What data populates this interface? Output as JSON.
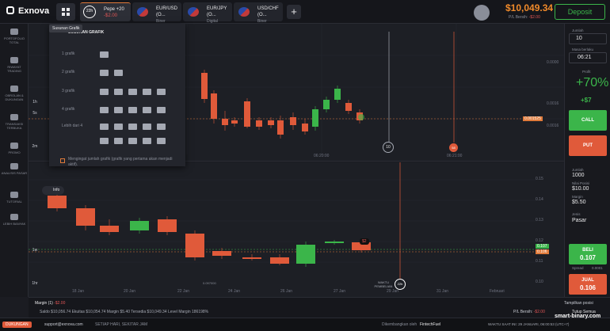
{
  "app": {
    "name": "Exnova"
  },
  "tooltip": "Susunan Grafik",
  "tabs": [
    {
      "timer": "22h",
      "title": "Pepe +20",
      "sub": "-$2.00",
      "active": true
    },
    {
      "title": "EUR/USD (O...",
      "sub": "Biner"
    },
    {
      "title": "EUR/JPY (O...",
      "sub": "Digital"
    },
    {
      "title": "USD/CHF (O...",
      "sub": "Biner"
    }
  ],
  "account": {
    "balance": "$10,049.34",
    "pl_label": "P/L Bersih:",
    "pl_value": "-$2.00",
    "deposit": "Deposit"
  },
  "sidebar": [
    {
      "label": "PORTOFOLIO TOTAL",
      "badge": "2"
    },
    {
      "label": "RIWAYAT TRADING"
    },
    {
      "label": "OBROLAN & DUKUNGAN"
    },
    {
      "label": "TRANSAKSI TERBUKA"
    },
    {
      "label": "PROMO"
    },
    {
      "label": "ANALISIS PASAR"
    },
    {
      "label": "TUTORIAL"
    },
    {
      "label": "LEBIH BANYAK"
    }
  ],
  "layout_menu": {
    "header": "SUSUNAN GRAFIK",
    "rows": [
      "1 grafik",
      "2 grafik",
      "3 grafik",
      "4 grafik",
      "Lebih dari 4"
    ],
    "note": "Mengingat jumlah grafik (grafik yang pertama akan menjadi aktif)."
  },
  "chart1": {
    "time_labels": [
      "06:20:00",
      "06:21:00"
    ],
    "price_tags": [
      "0.0000",
      "0.0000",
      "0.0000",
      "0.0000",
      "0.0016",
      "0.0016",
      "0.0016"
    ],
    "current_price": "0.001525",
    "timer1": "10",
    "timer2": "58",
    "tools": [
      "1h",
      "5s",
      "2m"
    ]
  },
  "chart2": {
    "dates": [
      "18 Jan",
      "20 Jan",
      "22 Jan",
      "24 Jan",
      "26 Jan",
      "27 Jan",
      "29 Jan",
      "31 Jan",
      "Februari"
    ],
    "price_axis": [
      "0.15",
      "0.14",
      "0.13",
      "0.12",
      "0.11",
      "0.10"
    ],
    "current": "0.106",
    "stake": "$2",
    "purchase_label": "WAKTU PEMBELIAN",
    "purchase_timer": "22h",
    "low_tag": "0.097000",
    "info_label": "Info",
    "tools": [
      "1w",
      "1hr"
    ]
  },
  "rpanel1": {
    "amount_label": "Jumlah",
    "amount": "10",
    "expiry_label": "Masa berlaku",
    "expiry": "06:21",
    "profit_label": "Profit",
    "profit_pct": "+70%",
    "profit_amt": "+$7",
    "call": "CALL",
    "put": "PUT"
  },
  "rpanel2": {
    "amount_label": "Jumlah",
    "amount": "1000",
    "pos_label": "Nilai Posisi",
    "pos": "$10.00",
    "margin_label": "Margin",
    "margin": "$5.50",
    "type_label": "Jenis",
    "type": "Pasar",
    "buy": "BELI",
    "buy_price": "0.107",
    "sell": "JUAL",
    "sell_price": "0.106",
    "spread_label": "Spread",
    "spread": "0.0001"
  },
  "bottom": {
    "margin_tab": "Margin (1)",
    "margin_pl": "-$2.00",
    "hide": "Tampilkan posisi",
    "stats": "Saldo $10,056.74   Ekuitas $10,054.74   Margin $5.40   Tersedia $10,049.34   Level Margin 186198%",
    "pl_label": "P/L Bersih:",
    "pl": "-$2.00",
    "close_all": "Tutup Semua"
  },
  "footer": {
    "support_btn": "DUKUNGAN",
    "email": "support@exnova.com",
    "hours": "SETIAP HARI, SEKITAR JAM",
    "dev": "Dikembangkan oleh",
    "brand": "FintechFuel",
    "time": "WAKTU SAAT INI: 29 JANUARI, 06:00:53 (UTC+7)",
    "watermark": "smart-binary.com"
  },
  "colors": {
    "bull": "#3bb54a",
    "bear": "#e05a3a",
    "accent": "#f08a2a"
  }
}
